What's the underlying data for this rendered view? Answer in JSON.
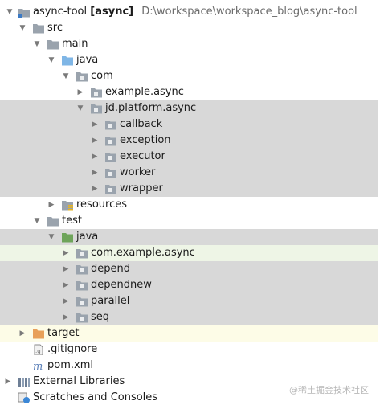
{
  "tree": {
    "root": {
      "label": "async-tool",
      "module": "[async]",
      "path": "D:\\workspace\\workspace_blog\\async-tool"
    },
    "src": "src",
    "main": "main",
    "main_java": "java",
    "com": "com",
    "example_async": "example.async",
    "jd_platform_async": "jd.platform.async",
    "callback": "callback",
    "exception": "exception",
    "executor": "executor",
    "worker": "worker",
    "wrapper": "wrapper",
    "resources": "resources",
    "test": "test",
    "test_java": "java",
    "com_example_async": "com.example.async",
    "depend": "depend",
    "dependnew": "dependnew",
    "parallel": "parallel",
    "seq": "seq",
    "target": "target",
    "gitignore": ".gitignore",
    "pom": "pom.xml",
    "external_libraries": "External Libraries",
    "scratches": "Scratches and Consoles"
  },
  "watermark": "@稀土掘金技术社区",
  "icons": {
    "folder": "folder-icon",
    "package": "package-icon",
    "source_root": "source-root-icon",
    "test_root": "test-root-icon",
    "resources": "resources-folder-icon",
    "excluded": "excluded-folder-icon",
    "module": "module-icon",
    "gitignore": "gitignore-file-icon",
    "maven": "maven-icon",
    "libraries": "libraries-icon",
    "scratches": "scratches-icon"
  },
  "colors": {
    "selection_gray": "#d8d8d8",
    "test_row_green": "#eef5e6",
    "target_row_yellow": "#fdfce7",
    "folder_gray": "#9aa3ad",
    "source_blue": "#7fb6e6",
    "test_green": "#6ea45a",
    "excluded_orange": "#e8a05a"
  }
}
